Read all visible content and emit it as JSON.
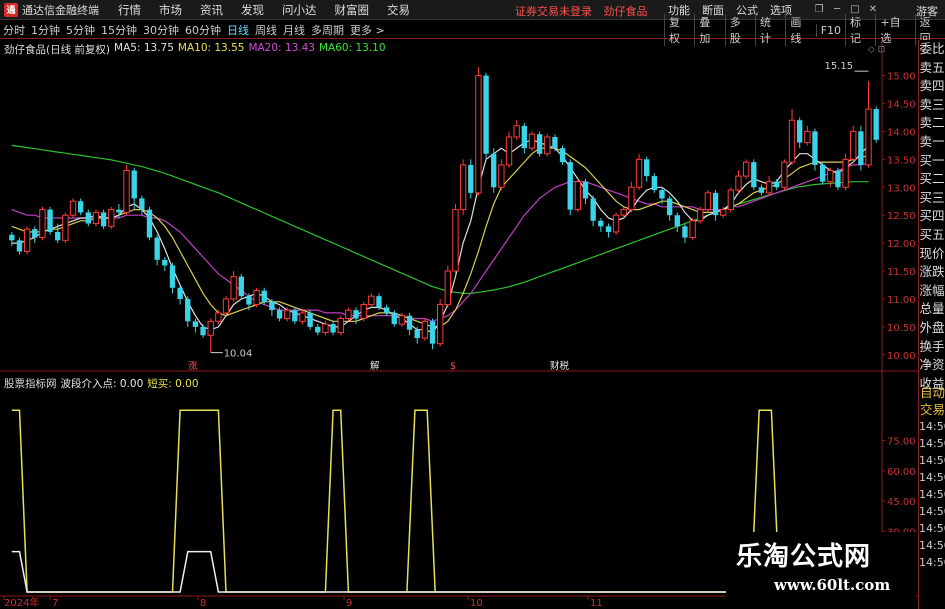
{
  "window": {
    "app_title": "通达信金融终端",
    "menu": [
      "行情",
      "市场",
      "资讯",
      "发现",
      "问小达",
      "财富圈",
      "交易"
    ],
    "status_warning": "证券交易未登录",
    "current_stock": "劲仔食品",
    "right_menu": [
      "功能",
      "断面",
      "公式",
      "选项"
    ],
    "guest": "游客"
  },
  "toolbar": {
    "periods": [
      "分时",
      "1分钟",
      "5分钟",
      "15分钟",
      "30分钟",
      "60分钟",
      "日线",
      "周线",
      "月线",
      "多周期",
      "更多 >"
    ],
    "active_period": "日线",
    "right_tools": [
      "复权",
      "叠加",
      "多股",
      "统计",
      "画线",
      "F10",
      "标记",
      "+自选",
      "返回"
    ]
  },
  "main_chart": {
    "title": "劲仔食品(日线 前复权)",
    "ma5": "MA5: 13.75",
    "ma10": "MA10: 13.55",
    "ma20": "MA20: 13.43",
    "ma60": "MA60: 13.10",
    "price_ticks": [
      "15.00",
      "14.50",
      "14.00",
      "13.50",
      "13.00",
      "12.50",
      "12.00",
      "11.50",
      "11.00",
      "10.50",
      "10.00"
    ],
    "low_label": "10.04",
    "high_label": "15.15",
    "event_marks": [
      "涨",
      "解",
      "$",
      "财税"
    ]
  },
  "indicator": {
    "title": "股票指标网",
    "v1": "波段介入点: 0.00",
    "v2": "短买: 0.00",
    "ticks": [
      "75.00",
      "60.00",
      "45.00",
      "30.00"
    ]
  },
  "x_axis": {
    "labels": [
      "2024年",
      "7",
      "8",
      "9",
      "10",
      "11"
    ]
  },
  "side_panel": {
    "items": [
      "委比",
      "卖五",
      "卖四",
      "卖三",
      "卖二",
      "卖一",
      "买一",
      "买二",
      "买三",
      "买四",
      "买五",
      "现价",
      "涨跌",
      "涨幅",
      "总量",
      "外盘",
      "换手",
      "净资",
      "收益"
    ],
    "lower_items": [
      "自动",
      "交易"
    ],
    "times": [
      "14:50",
      "14:50",
      "14:50",
      "14:50",
      "14:50",
      "14:50",
      "14:50",
      "14:50",
      "14:50"
    ]
  },
  "watermark": {
    "line1": "乐淘公式网",
    "line2": "www.60lt.com"
  },
  "chart_data": {
    "type": "candlestick",
    "price_range": [
      9.8,
      15.35
    ],
    "indicator_range": [
      0,
      100
    ],
    "candles": [
      [
        12.15,
        12.05,
        12.2,
        11.95
      ],
      [
        12.05,
        11.85,
        12.1,
        11.8
      ],
      [
        11.85,
        12.25,
        12.3,
        11.8
      ],
      [
        12.25,
        12.1,
        12.3,
        12.0
      ],
      [
        12.1,
        12.6,
        12.65,
        12.05
      ],
      [
        12.6,
        12.2,
        12.65,
        12.15
      ],
      [
        12.2,
        12.05,
        12.35,
        12.0
      ],
      [
        12.05,
        12.5,
        12.55,
        12.0
      ],
      [
        12.5,
        12.75,
        12.8,
        12.45
      ],
      [
        12.75,
        12.55,
        12.8,
        12.5
      ],
      [
        12.55,
        12.35,
        12.6,
        12.3
      ],
      [
        12.35,
        12.55,
        12.6,
        12.3
      ],
      [
        12.55,
        12.3,
        12.6,
        12.25
      ],
      [
        12.3,
        12.6,
        12.65,
        12.25
      ],
      [
        12.6,
        12.55,
        12.7,
        12.45
      ],
      [
        12.55,
        13.3,
        13.4,
        12.5
      ],
      [
        13.3,
        12.8,
        13.35,
        12.6
      ],
      [
        12.8,
        12.6,
        12.85,
        12.5
      ],
      [
        12.6,
        12.1,
        12.65,
        12.05
      ],
      [
        12.1,
        11.7,
        12.15,
        11.6
      ],
      [
        11.7,
        11.6,
        11.75,
        11.5
      ],
      [
        11.6,
        11.2,
        11.65,
        11.1
      ],
      [
        11.2,
        11.0,
        11.25,
        10.9
      ],
      [
        11.0,
        10.6,
        11.05,
        10.5
      ],
      [
        10.6,
        10.5,
        10.65,
        10.4
      ],
      [
        10.5,
        10.35,
        10.55,
        10.3
      ],
      [
        10.35,
        10.6,
        10.65,
        10.04
      ],
      [
        10.6,
        10.75,
        10.8,
        10.55
      ],
      [
        10.75,
        11.0,
        11.05,
        10.7
      ],
      [
        11.0,
        11.4,
        11.5,
        10.95
      ],
      [
        11.4,
        11.05,
        11.45,
        11.0
      ],
      [
        11.05,
        10.9,
        11.1,
        10.8
      ],
      [
        10.9,
        11.15,
        11.2,
        10.85
      ],
      [
        11.15,
        10.95,
        11.2,
        10.9
      ],
      [
        10.95,
        10.8,
        11.0,
        10.7
      ],
      [
        10.8,
        10.65,
        10.85,
        10.6
      ],
      [
        10.65,
        10.8,
        10.85,
        10.6
      ],
      [
        10.8,
        10.6,
        10.85,
        10.55
      ],
      [
        10.6,
        10.75,
        10.8,
        10.55
      ],
      [
        10.75,
        10.5,
        10.8,
        10.45
      ],
      [
        10.5,
        10.4,
        10.55,
        10.35
      ],
      [
        10.4,
        10.55,
        10.6,
        10.35
      ],
      [
        10.55,
        10.4,
        10.6,
        10.35
      ],
      [
        10.4,
        10.65,
        10.7,
        10.35
      ],
      [
        10.65,
        10.8,
        10.85,
        10.6
      ],
      [
        10.8,
        10.65,
        10.85,
        10.55
      ],
      [
        10.65,
        10.9,
        10.95,
        10.6
      ],
      [
        10.9,
        11.05,
        11.1,
        10.85
      ],
      [
        11.05,
        10.85,
        11.1,
        10.8
      ],
      [
        10.85,
        10.75,
        10.9,
        10.7
      ],
      [
        10.75,
        10.55,
        10.8,
        10.5
      ],
      [
        10.55,
        10.7,
        10.75,
        10.5
      ],
      [
        10.7,
        10.45,
        10.75,
        10.35
      ],
      [
        10.45,
        10.3,
        10.5,
        10.2
      ],
      [
        10.3,
        10.6,
        10.65,
        10.25
      ],
      [
        10.6,
        10.2,
        10.65,
        10.1
      ],
      [
        10.2,
        10.9,
        11.0,
        10.15
      ],
      [
        10.9,
        11.5,
        11.6,
        10.85
      ],
      [
        11.5,
        12.6,
        12.7,
        11.45
      ],
      [
        12.6,
        13.4,
        13.5,
        12.5
      ],
      [
        13.4,
        12.9,
        13.5,
        12.8
      ],
      [
        12.9,
        15.0,
        15.15,
        12.85
      ],
      [
        15.0,
        13.6,
        15.05,
        13.5
      ],
      [
        13.6,
        13.0,
        13.7,
        12.9
      ],
      [
        13.0,
        13.4,
        13.5,
        12.95
      ],
      [
        13.4,
        13.9,
        14.0,
        13.35
      ],
      [
        13.9,
        14.1,
        14.2,
        13.85
      ],
      [
        14.1,
        13.7,
        14.15,
        13.6
      ],
      [
        13.7,
        13.95,
        14.0,
        13.65
      ],
      [
        13.95,
        13.6,
        14.0,
        13.55
      ],
      [
        13.6,
        13.9,
        13.95,
        13.55
      ],
      [
        13.9,
        13.7,
        13.95,
        13.65
      ],
      [
        13.7,
        13.45,
        13.75,
        13.4
      ],
      [
        13.45,
        12.6,
        13.5,
        12.5
      ],
      [
        12.6,
        13.1,
        13.15,
        12.55
      ],
      [
        13.1,
        12.8,
        13.15,
        12.7
      ],
      [
        12.8,
        12.4,
        12.85,
        12.3
      ],
      [
        12.4,
        12.3,
        12.45,
        12.2
      ],
      [
        12.3,
        12.2,
        12.35,
        12.1
      ],
      [
        12.2,
        12.5,
        12.55,
        12.15
      ],
      [
        12.5,
        12.6,
        12.65,
        12.45
      ],
      [
        12.6,
        13.0,
        13.1,
        12.55
      ],
      [
        13.0,
        13.5,
        13.6,
        12.95
      ],
      [
        13.5,
        13.2,
        13.55,
        13.1
      ],
      [
        13.2,
        12.95,
        13.25,
        12.9
      ],
      [
        12.95,
        12.8,
        13.0,
        12.7
      ],
      [
        12.8,
        12.5,
        12.85,
        12.4
      ],
      [
        12.5,
        12.3,
        12.55,
        12.2
      ],
      [
        12.3,
        12.1,
        12.35,
        12.0
      ],
      [
        12.1,
        12.4,
        12.45,
        12.05
      ],
      [
        12.4,
        12.6,
        12.65,
        12.35
      ],
      [
        12.6,
        12.9,
        12.95,
        12.55
      ],
      [
        12.9,
        12.5,
        12.95,
        12.4
      ],
      [
        12.5,
        12.6,
        12.65,
        12.45
      ],
      [
        12.6,
        12.95,
        13.0,
        12.55
      ],
      [
        12.95,
        13.2,
        13.3,
        12.9
      ],
      [
        13.2,
        13.45,
        13.5,
        13.15
      ],
      [
        13.45,
        13.0,
        13.5,
        12.95
      ],
      [
        13.0,
        12.9,
        13.05,
        12.85
      ],
      [
        12.9,
        13.1,
        13.2,
        12.85
      ],
      [
        13.1,
        13.0,
        13.15,
        12.95
      ],
      [
        13.0,
        13.45,
        13.5,
        12.95
      ],
      [
        13.45,
        14.2,
        14.4,
        13.4
      ],
      [
        14.2,
        13.8,
        14.25,
        13.7
      ],
      [
        13.8,
        14.0,
        14.1,
        13.75
      ],
      [
        14.0,
        13.4,
        14.05,
        13.3
      ],
      [
        13.4,
        13.1,
        13.45,
        13.05
      ],
      [
        13.1,
        13.3,
        13.35,
        13.0
      ],
      [
        13.3,
        13.0,
        13.35,
        12.95
      ],
      [
        13.0,
        13.5,
        13.6,
        12.95
      ],
      [
        13.5,
        14.0,
        14.1,
        13.45
      ],
      [
        14.0,
        13.4,
        14.1,
        13.3
      ],
      [
        13.4,
        14.4,
        14.9,
        13.35
      ],
      [
        14.4,
        13.85,
        14.45,
        13.8
      ]
    ],
    "ma5": [
      12.0,
      12.0,
      12.05,
      12.1,
      12.2,
      12.25,
      12.3,
      12.35,
      12.4,
      12.45,
      12.45,
      12.5,
      12.45,
      12.45,
      12.5,
      12.65,
      12.7,
      12.6,
      12.45,
      12.2,
      11.9,
      11.55,
      11.25,
      10.95,
      10.7,
      10.5,
      10.45,
      10.5,
      10.7,
      10.9,
      11.0,
      11.05,
      11.1,
      11.05,
      10.95,
      10.9,
      10.8,
      10.75,
      10.7,
      10.65,
      10.6,
      10.55,
      10.5,
      10.5,
      10.6,
      10.7,
      10.8,
      10.85,
      10.85,
      10.8,
      10.7,
      10.65,
      10.55,
      10.45,
      10.45,
      10.4,
      10.6,
      10.9,
      11.4,
      12.0,
      12.4,
      13.0,
      13.5,
      13.6,
      13.7,
      13.6,
      13.7,
      13.8,
      13.85,
      13.8,
      13.75,
      13.7,
      13.55,
      13.35,
      13.15,
      12.95,
      12.8,
      12.6,
      12.45,
      12.4,
      12.45,
      12.6,
      12.8,
      12.95,
      13.0,
      13.0,
      12.9,
      12.75,
      12.55,
      12.4,
      12.4,
      12.5,
      12.55,
      12.6,
      12.7,
      12.9,
      13.05,
      13.15,
      13.1,
      13.05,
      13.1,
      13.3,
      13.45,
      13.6,
      13.6,
      13.5,
      13.4,
      13.3,
      13.25,
      13.35,
      13.45,
      13.6,
      13.75
    ],
    "ma10": [
      12.3,
      12.25,
      12.2,
      12.2,
      12.2,
      12.25,
      12.25,
      12.3,
      12.35,
      12.4,
      12.4,
      12.45,
      12.45,
      12.45,
      12.5,
      12.55,
      12.6,
      12.6,
      12.55,
      12.45,
      12.3,
      12.1,
      11.85,
      11.6,
      11.35,
      11.1,
      10.9,
      10.75,
      10.7,
      10.75,
      10.8,
      10.85,
      10.9,
      10.95,
      10.95,
      10.95,
      10.9,
      10.85,
      10.8,
      10.75,
      10.7,
      10.65,
      10.6,
      10.6,
      10.6,
      10.6,
      10.65,
      10.7,
      10.75,
      10.75,
      10.75,
      10.7,
      10.65,
      10.6,
      10.55,
      10.5,
      10.5,
      10.6,
      10.8,
      11.1,
      11.45,
      11.85,
      12.3,
      12.7,
      13.0,
      13.15,
      13.3,
      13.45,
      13.6,
      13.7,
      13.7,
      13.7,
      13.65,
      13.55,
      13.45,
      13.35,
      13.2,
      13.05,
      12.9,
      12.75,
      12.65,
      12.6,
      12.6,
      12.65,
      12.7,
      12.75,
      12.75,
      12.7,
      12.65,
      12.6,
      12.55,
      12.55,
      12.55,
      12.6,
      12.65,
      12.7,
      12.8,
      12.9,
      12.95,
      13.0,
      13.05,
      13.15,
      13.25,
      13.35,
      13.4,
      13.45,
      13.45,
      13.45,
      13.45,
      13.45,
      13.5,
      13.55,
      13.55
    ],
    "ma20": [
      12.6,
      12.55,
      12.5,
      12.5,
      12.45,
      12.45,
      12.45,
      12.45,
      12.45,
      12.45,
      12.45,
      12.45,
      12.45,
      12.45,
      12.45,
      12.5,
      12.5,
      12.5,
      12.45,
      12.45,
      12.4,
      12.3,
      12.2,
      12.05,
      11.9,
      11.75,
      11.6,
      11.45,
      11.35,
      11.25,
      11.15,
      11.05,
      10.95,
      10.9,
      10.85,
      10.8,
      10.8,
      10.8,
      10.8,
      10.8,
      10.8,
      10.75,
      10.75,
      10.75,
      10.7,
      10.7,
      10.7,
      10.7,
      10.7,
      10.7,
      10.7,
      10.7,
      10.65,
      10.65,
      10.65,
      10.6,
      10.65,
      10.7,
      10.8,
      10.95,
      11.1,
      11.3,
      11.5,
      11.7,
      11.9,
      12.1,
      12.3,
      12.5,
      12.65,
      12.8,
      12.9,
      13.0,
      13.05,
      13.1,
      13.1,
      13.1,
      13.05,
      13.0,
      12.95,
      12.9,
      12.85,
      12.8,
      12.75,
      12.7,
      12.7,
      12.65,
      12.65,
      12.65,
      12.65,
      12.65,
      12.6,
      12.6,
      12.6,
      12.6,
      12.65,
      12.65,
      12.7,
      12.75,
      12.8,
      12.85,
      12.9,
      12.95,
      13.0,
      13.05,
      13.1,
      13.15,
      13.2,
      13.25,
      13.3,
      13.35,
      13.4,
      13.4,
      13.43
    ],
    "ma60": [
      13.75,
      13.73,
      13.71,
      13.69,
      13.67,
      13.65,
      13.63,
      13.61,
      13.59,
      13.57,
      13.55,
      13.53,
      13.51,
      13.49,
      13.46,
      13.43,
      13.4,
      13.37,
      13.33,
      13.29,
      13.25,
      13.2,
      13.15,
      13.1,
      13.05,
      13.0,
      12.95,
      12.9,
      12.84,
      12.78,
      12.72,
      12.66,
      12.6,
      12.54,
      12.48,
      12.42,
      12.36,
      12.3,
      12.24,
      12.18,
      12.12,
      12.06,
      12.0,
      11.94,
      11.88,
      11.82,
      11.76,
      11.7,
      11.64,
      11.58,
      11.52,
      11.46,
      11.4,
      11.34,
      11.28,
      11.22,
      11.18,
      11.14,
      11.12,
      11.1,
      11.1,
      11.12,
      11.14,
      11.16,
      11.19,
      11.22,
      11.26,
      11.3,
      11.35,
      11.4,
      11.45,
      11.5,
      11.55,
      11.6,
      11.65,
      11.7,
      11.75,
      11.8,
      11.85,
      11.9,
      11.95,
      12.0,
      12.05,
      12.1,
      12.15,
      12.2,
      12.25,
      12.3,
      12.35,
      12.4,
      12.45,
      12.5,
      12.55,
      12.6,
      12.65,
      12.7,
      12.74,
      12.78,
      12.82,
      12.86,
      12.9,
      12.94,
      12.98,
      13.01,
      13.03,
      13.05,
      13.06,
      13.07,
      13.08,
      13.09,
      13.1,
      13.1,
      13.1
    ],
    "indicator_yellow": [
      90,
      90,
      0,
      0,
      0,
      0,
      0,
      0,
      0,
      0,
      0,
      0,
      0,
      0,
      0,
      0,
      0,
      0,
      0,
      0,
      0,
      0,
      90,
      90,
      90,
      90,
      90,
      90,
      0,
      0,
      0,
      0,
      0,
      0,
      0,
      0,
      0,
      0,
      0,
      0,
      0,
      0,
      90,
      90,
      0,
      0,
      0,
      0,
      0,
      0,
      0,
      0,
      0,
      0,
      0,
      0,
      0,
      0,
      0,
      0,
      0,
      0,
      0,
      0,
      0,
      0,
      0,
      0,
      0,
      0,
      0,
      0,
      0,
      0,
      0,
      0,
      0,
      0,
      0,
      0,
      0,
      0,
      0,
      0,
      0,
      0,
      0,
      0,
      0,
      0,
      0,
      0,
      0,
      0,
      0,
      0,
      0,
      0,
      0,
      0,
      0,
      0,
      0,
      0,
      0,
      0,
      0,
      0,
      0,
      0,
      0,
      0,
      0
    ],
    "indicator_white": [
      20,
      20,
      0,
      0,
      0,
      0,
      0,
      0,
      0,
      0,
      0,
      0,
      0,
      0,
      0,
      0,
      0,
      0,
      0,
      0,
      0,
      0,
      0,
      20,
      20,
      20,
      20,
      0,
      0,
      0,
      0,
      0,
      0,
      0,
      0,
      0,
      0,
      0,
      0,
      0,
      0,
      0,
      0,
      0,
      0,
      0,
      0,
      0,
      0,
      0,
      0,
      0,
      0,
      0,
      0,
      0,
      0,
      0,
      0,
      0,
      0,
      0,
      0,
      0,
      0,
      0,
      0,
      0,
      0,
      0,
      0,
      0,
      0,
      0,
      0,
      0,
      0,
      0,
      0,
      0,
      0,
      0,
      0,
      0,
      0,
      0,
      0,
      0,
      0,
      0,
      0,
      0,
      0,
      0,
      0,
      0,
      0,
      0,
      0,
      0,
      0,
      0,
      0,
      0,
      0,
      0,
      0,
      0,
      0,
      0,
      0,
      0,
      0
    ]
  }
}
